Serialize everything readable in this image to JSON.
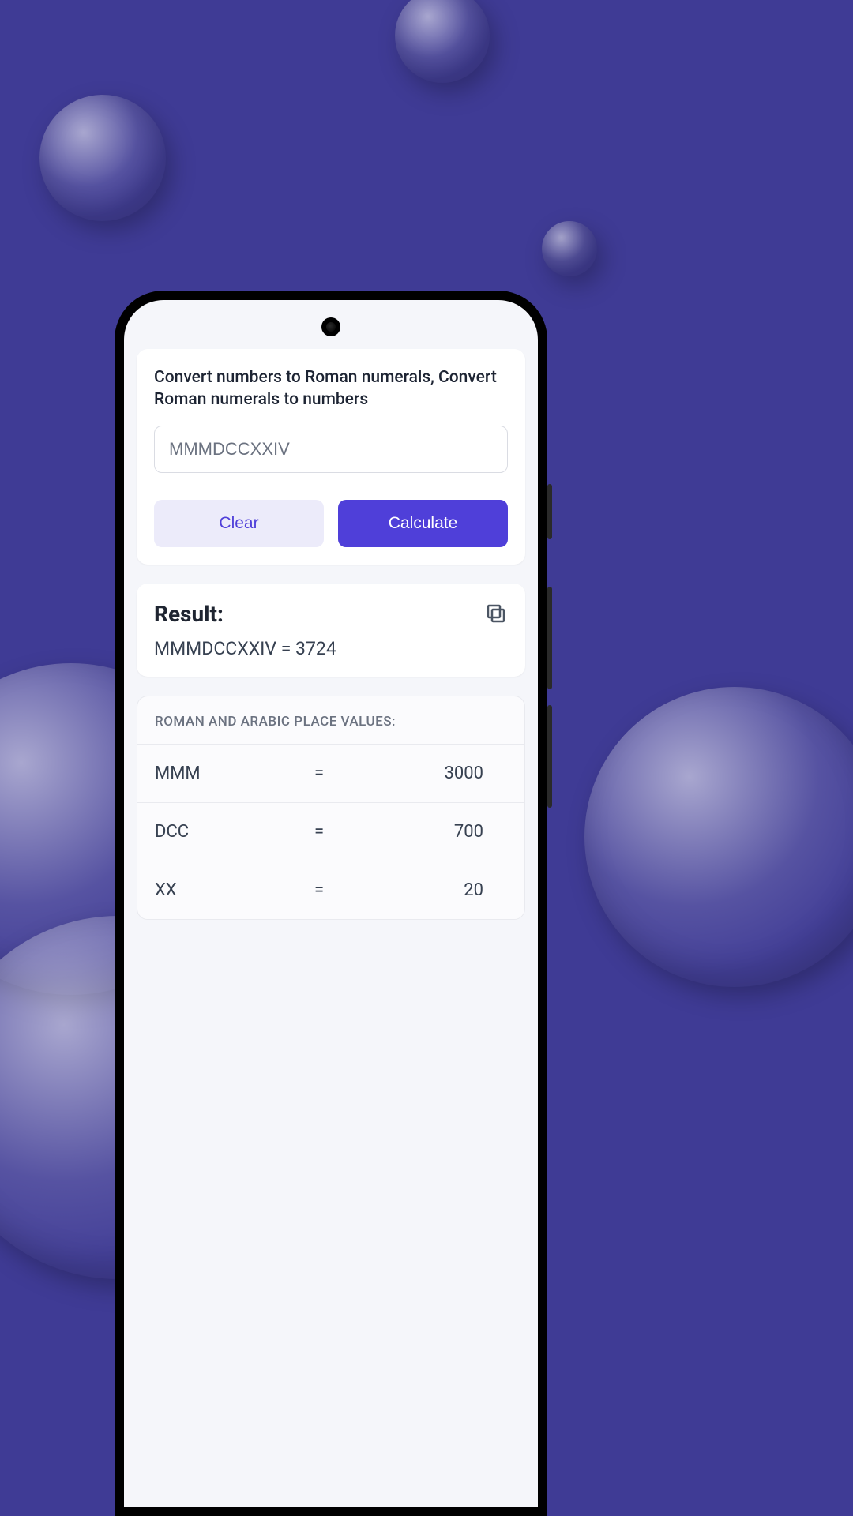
{
  "converter": {
    "description": "Convert numbers to Roman numerals, Convert Roman numerals to numbers",
    "input_value": "MMMDCCXXIV",
    "clear_label": "Clear",
    "calculate_label": "Calculate"
  },
  "result": {
    "title": "Result:",
    "value": "MMMDCCXXIV = 3724"
  },
  "place_values": {
    "title": "ROMAN AND ARABIC PLACE VALUES:",
    "rows": [
      {
        "roman": "MMM",
        "eq": "=",
        "value": "3000"
      },
      {
        "roman": "DCC",
        "eq": "=",
        "value": "700"
      },
      {
        "roman": "XX",
        "eq": "=",
        "value": "20"
      }
    ]
  }
}
